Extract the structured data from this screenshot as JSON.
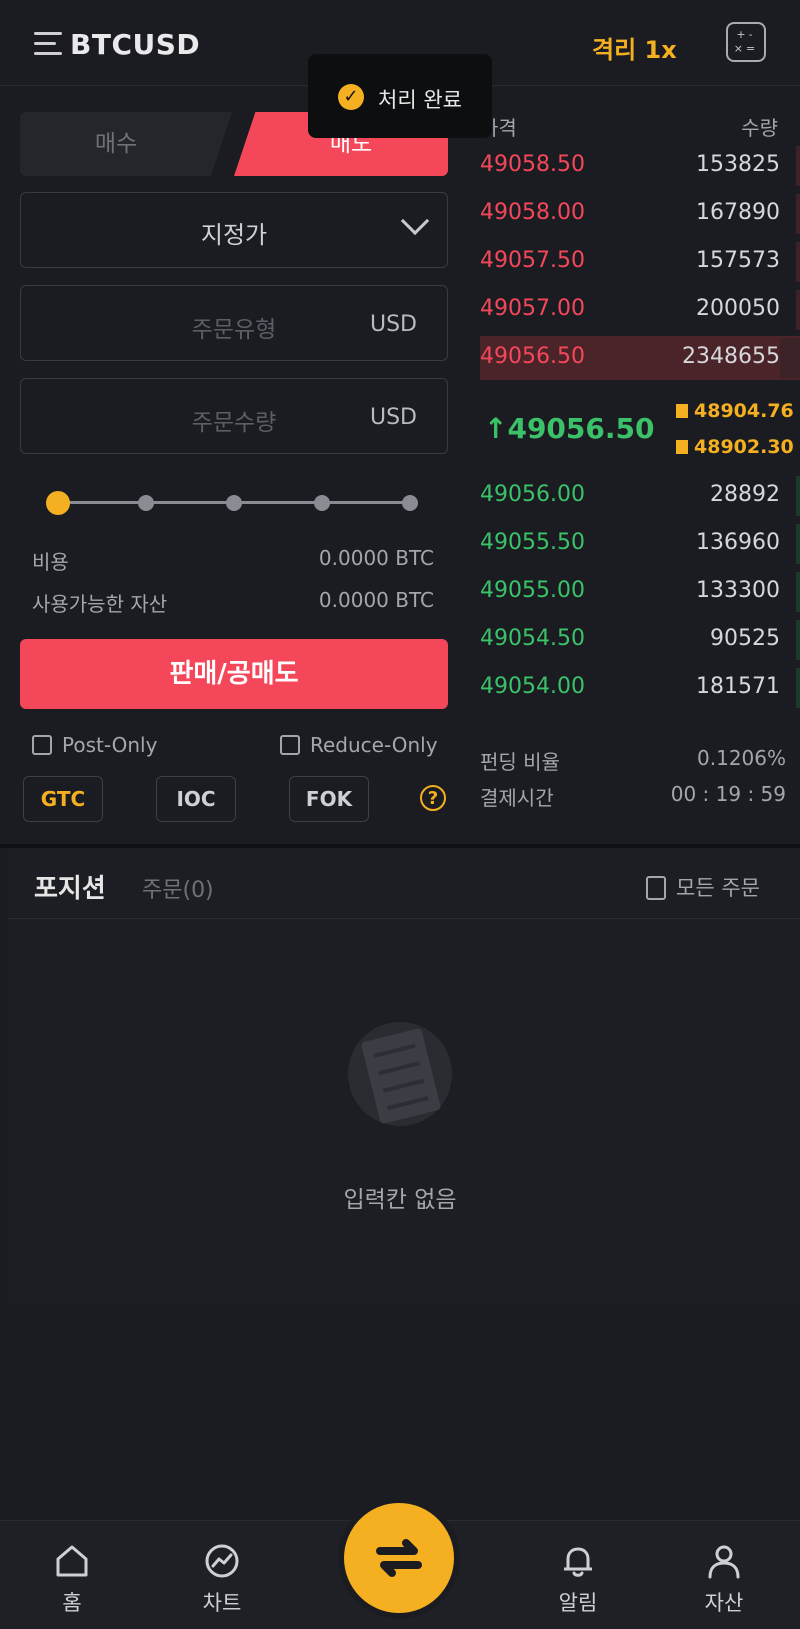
{
  "header": {
    "symbol": "BTCUSD",
    "leverage": "격리 1x",
    "calculator_glyph": "+-×="
  },
  "toast": {
    "text": "처리 완료"
  },
  "order_form": {
    "tabs": {
      "buy": "매수",
      "sell": "매도"
    },
    "active_tab": "sell",
    "order_type": "지정가",
    "price_field": {
      "placeholder": "주문유형",
      "unit": "USD"
    },
    "qty_field": {
      "placeholder": "주문수량",
      "unit": "USD"
    },
    "slider_level": 0,
    "cost_label": "비용",
    "cost_value": "0.0000 BTC",
    "available_label": "사용가능한 자산",
    "available_value": "0.0000 BTC",
    "submit_label": "판매/공매도",
    "post_only": "Post-Only",
    "reduce_only": "Reduce-Only",
    "tif": [
      "GTC",
      "IOC",
      "FOK"
    ],
    "tif_active": "GTC",
    "help": "?"
  },
  "orderbook": {
    "price_header": "가격",
    "qty_header": "수량",
    "asks": [
      {
        "price": "49058.50",
        "qty": "153825",
        "depth": 0.07
      },
      {
        "price": "49058.00",
        "qty": "167890",
        "depth": 0.07
      },
      {
        "price": "49057.50",
        "qty": "157573",
        "depth": 0.07
      },
      {
        "price": "49057.00",
        "qty": "200050",
        "depth": 0.09
      },
      {
        "price": "49056.50",
        "qty": "2348655",
        "depth": 1.0
      }
    ],
    "last_price": "49056.50",
    "mark_price": "48904.76",
    "index_price": "48902.30",
    "bids": [
      {
        "price": "49056.00",
        "qty": "28892",
        "depth": 0.02
      },
      {
        "price": "49055.50",
        "qty": "136960",
        "depth": 0.06
      },
      {
        "price": "49055.00",
        "qty": "133300",
        "depth": 0.06
      },
      {
        "price": "49054.50",
        "qty": "90525",
        "depth": 0.04
      },
      {
        "price": "49054.00",
        "qty": "181571",
        "depth": 0.08
      }
    ],
    "funding_label": "펀딩 비율",
    "funding_value": "0.1206%",
    "settle_label": "결제시간",
    "settle_value": "00 : 19 : 59"
  },
  "positions": {
    "tab_positions": "포지션",
    "tab_orders": "주문(0)",
    "all_orders": "모든 주문",
    "empty_text": "입력칸 없음"
  },
  "nav": {
    "home": "홈",
    "chart": "차트",
    "alerts": "알림",
    "assets": "자산"
  },
  "colors": {
    "accent": "#f5b021",
    "sell": "#f5475a",
    "buy": "#3bc268",
    "background": "#1b1c21"
  }
}
